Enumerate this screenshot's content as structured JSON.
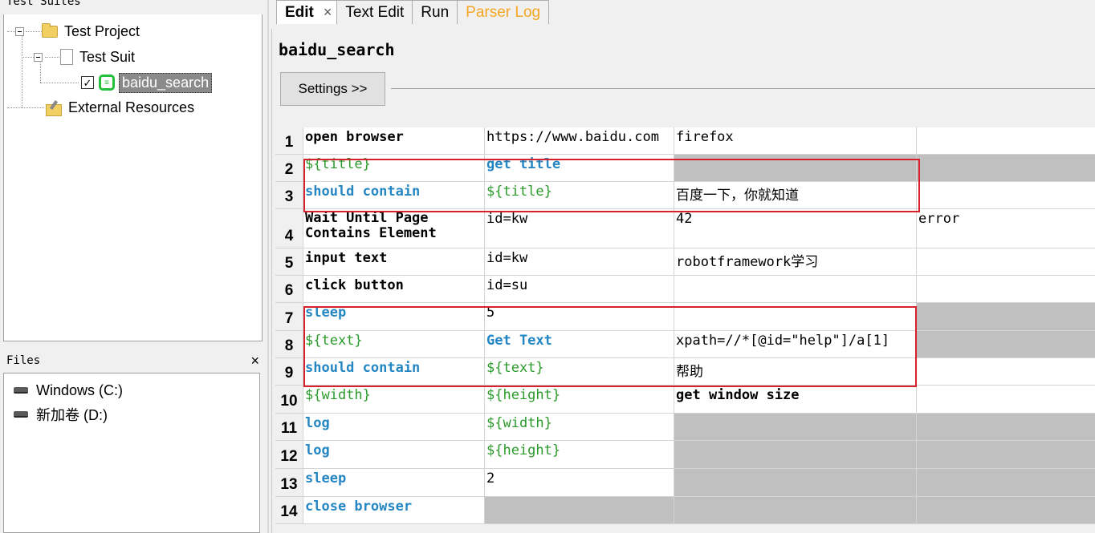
{
  "left_panel": {
    "suites_title": "Test Suites",
    "tree": {
      "project": "Test Project",
      "suite": "Test Suit",
      "testcase": "baidu_search",
      "testcase_checked": "✓",
      "resources": "External Resources"
    },
    "files": {
      "title": "Files",
      "close": "×",
      "drives": [
        "Windows (C:)",
        "新加卷 (D:)"
      ]
    }
  },
  "tabs": [
    {
      "label": "Edit",
      "active": true,
      "close": "×"
    },
    {
      "label": "Text Edit"
    },
    {
      "label": "Run"
    },
    {
      "label": "Parser Log",
      "color": "#f5a623"
    }
  ],
  "editor": {
    "name": "baidu_search",
    "settings_label": "Settings >>"
  },
  "grid": {
    "rows": [
      {
        "num": "1",
        "cells": [
          "open browser",
          "https://www.baidu.com",
          "firefox",
          ""
        ]
      },
      {
        "num": "2",
        "cells": [
          "${title}",
          "get title",
          "",
          ""
        ]
      },
      {
        "num": "3",
        "cells": [
          "should contain",
          "${title}",
          "百度一下，你就知道",
          ""
        ]
      },
      {
        "num": "4",
        "cells": [
          "Wait Until Page Contains Element",
          "id=kw",
          "42",
          "error"
        ]
      },
      {
        "num": "5",
        "cells": [
          "input text",
          "id=kw",
          "robotframework学习",
          ""
        ]
      },
      {
        "num": "6",
        "cells": [
          "click button",
          "id=su",
          "",
          ""
        ]
      },
      {
        "num": "7",
        "cells": [
          "sleep",
          "5",
          "",
          ""
        ]
      },
      {
        "num": "8",
        "cells": [
          "${text}",
          " Get Text",
          "xpath=//*[@id=\"help\"]/a[1]",
          ""
        ]
      },
      {
        "num": "9",
        "cells": [
          "should contain",
          "${text}",
          "帮助",
          ""
        ]
      },
      {
        "num": "10",
        "cells": [
          "${width}",
          "${height}",
          " get window size",
          ""
        ]
      },
      {
        "num": "11",
        "cells": [
          "log",
          "${width}",
          "",
          ""
        ]
      },
      {
        "num": "12",
        "cells": [
          "log",
          "${height}",
          "",
          ""
        ]
      },
      {
        "num": "13",
        "cells": [
          "sleep",
          "2",
          "",
          ""
        ]
      },
      {
        "num": "14",
        "cells": [
          "close browser",
          "",
          "",
          ""
        ]
      }
    ]
  },
  "colors": {
    "keyword_blue": "#2486c3",
    "variable_green": "#2a9a2a",
    "highlight_red": "#d5202e",
    "parser_log_orange": "#f5a623"
  }
}
